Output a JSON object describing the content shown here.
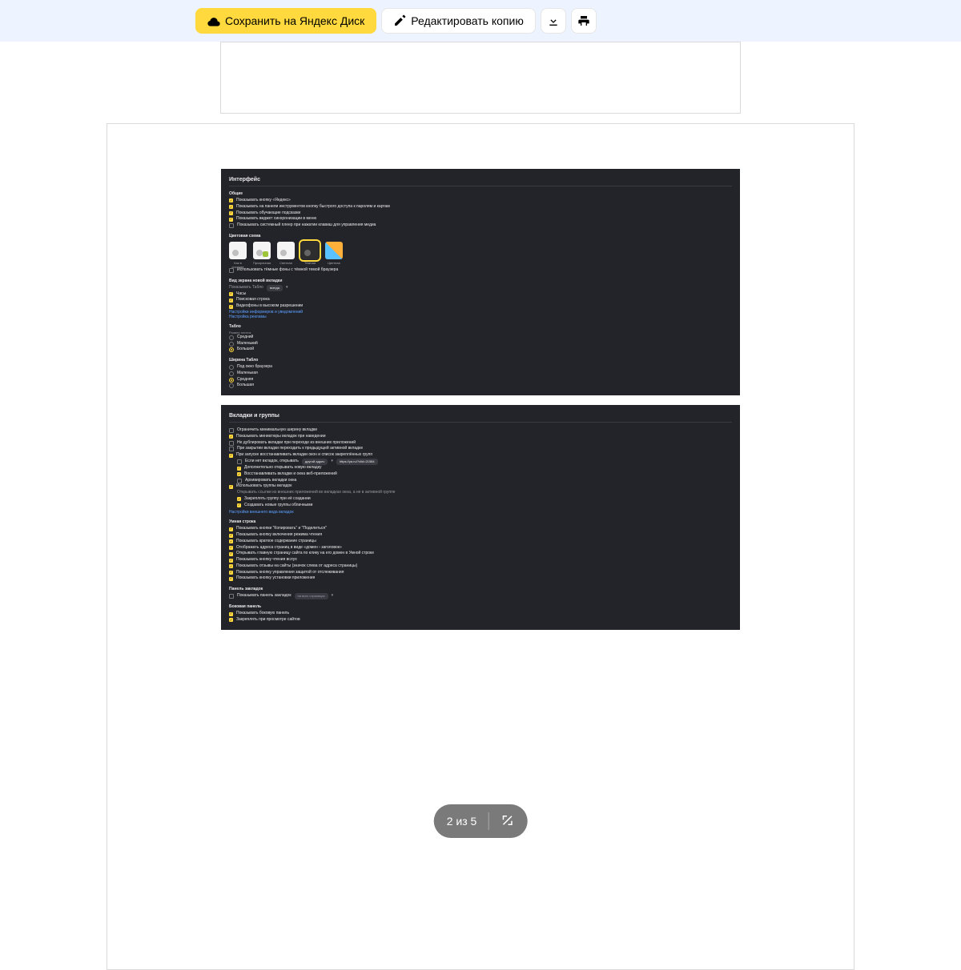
{
  "toolbar": {
    "save": "Сохранить на Яндекс Диск",
    "edit": "Редактировать копию"
  },
  "footer": {
    "page_indicator": "2 из 5"
  },
  "settings": {
    "panel1_title": "Интерфейс",
    "general_head": "Общие",
    "general": [
      {
        "checked": true,
        "label": "Показывать кнопку «Яндекс»"
      },
      {
        "checked": true,
        "label": "Показывать на панели инструментов кнопку быстрого доступа к паролям и картам"
      },
      {
        "checked": true,
        "label": "Показывать обучающие подсказки"
      },
      {
        "checked": true,
        "label": "Показывать виджет синхронизации в меню"
      },
      {
        "checked": false,
        "label": "Показывать системный плеер при нажатии клавиш для управления медиа"
      }
    ],
    "color_head": "Цветовая схема",
    "themes": [
      {
        "label": "Как в системе"
      },
      {
        "label": "Прозрачная"
      },
      {
        "label": "Светлая"
      },
      {
        "label": "Тёмная",
        "selected": true
      },
      {
        "label": "Цветная"
      }
    ],
    "color_opt": {
      "checked": false,
      "label": "Использовать тёмные фоны с тёмной темой браузера"
    },
    "newtab_head": "Вид экрана новой вкладки",
    "newtab_show_label": "Показывать Табло",
    "newtab_show_value": "всегда",
    "newtab_opts": [
      {
        "checked": true,
        "label": "Часы"
      },
      {
        "checked": true,
        "label": "Поисковая строка"
      },
      {
        "checked": true,
        "label": "Видеофоны в высоком разрешении"
      }
    ],
    "newtab_links": [
      "Настройки информеров и уведомлений",
      "Настройка рекламы"
    ],
    "tablo_head": "Табло",
    "tablo_size_head": "Размер плиток",
    "tablo_size_opts": [
      {
        "sel": false,
        "label": "Средний"
      },
      {
        "sel": false,
        "label": "Маленький"
      },
      {
        "sel": true,
        "label": "Большой"
      }
    ],
    "tablo_width_head": "Ширина Табло",
    "tablo_width_opts": [
      {
        "sel": false,
        "label": "Под окно браузера"
      },
      {
        "sel": false,
        "label": "Маленькая"
      },
      {
        "sel": true,
        "label": "Средняя"
      },
      {
        "sel": false,
        "label": "Большая"
      }
    ],
    "panel2_title": "Вкладки и группы",
    "tabs": [
      {
        "checked": false,
        "label": "Ограничить минимальную ширину вкладки"
      },
      {
        "checked": true,
        "label": "Показывать миниатюры вкладок при наведении"
      },
      {
        "checked": false,
        "label": "Не дублировать вкладки при переходе из внешних приложений"
      },
      {
        "checked": false,
        "label": "При закрытии вкладки переходить к предыдущей активной вкладке"
      },
      {
        "checked": true,
        "label": "При запуске восстанавливать вкладки окон и список закреплённых групп"
      }
    ],
    "tabs_sub1_label": "Если нет вкладок, открывать",
    "tabs_sub1_sel": "другой адрес",
    "tabs_sub1_url": "https://ya.ru/?clid=21584",
    "tabs_sub2": [
      {
        "checked": true,
        "label": "Дополнительно открывать новую вкладку"
      },
      {
        "checked": true,
        "label": "Восстанавливать вкладки и окна веб-приложений"
      },
      {
        "checked": false,
        "label": "Архивировать вкладки окна"
      }
    ],
    "tabs_groups": {
      "checked": true,
      "label": "Использовать группы вкладок"
    },
    "tabs_groups_sub": [
      {
        "type": "txt",
        "label": "Открывать ссылки из внешних приложений во вкладках окна, а не в активной группе"
      },
      {
        "type": "cb",
        "checked": true,
        "label": "Закреплять группу при её создании"
      },
      {
        "type": "cb",
        "checked": true,
        "label": "Создавать новые группы облачными"
      }
    ],
    "tabs_link": "Настройки внешнего вида вкладок",
    "smart_head": "Умная строка",
    "smart": [
      {
        "checked": true,
        "label": "Показывать кнопки \"Копировать\" и \"Поделиться\""
      },
      {
        "checked": true,
        "label": "Показывать кнопку включения режима чтения"
      },
      {
        "checked": true,
        "label": "Показывать краткое содержание страницы"
      },
      {
        "checked": true,
        "label": "Отображать адреса страниц в виде «домен › заголовок»"
      },
      {
        "checked": true,
        "label": "Открывать главную страницу сайта по клику на его домен в Умной строке"
      },
      {
        "checked": true,
        "label": "Показывать кнопку чтения вслух"
      },
      {
        "checked": true,
        "label": "Показывать отзывы на сайты (значок слева от адреса страницы)"
      },
      {
        "checked": true,
        "label": "Показывать кнопку управления защитой от отслеживания"
      },
      {
        "checked": true,
        "label": "Показывать кнопку установки приложения"
      }
    ],
    "bookbar_head": "Панель закладок",
    "bookbar": {
      "checked": false,
      "label": "Показывать панель закладок",
      "sel": "на всех страницах"
    },
    "sidebar_head": "Боковая панель",
    "sidebar": [
      {
        "checked": true,
        "label": "Показывать боковую панель"
      },
      {
        "checked": true,
        "label": "Закреплять при просмотре сайтов"
      }
    ]
  }
}
